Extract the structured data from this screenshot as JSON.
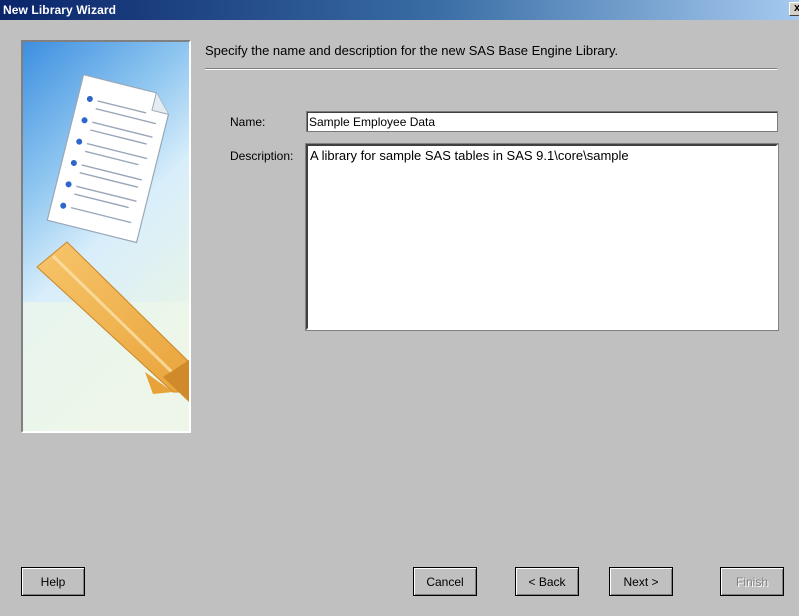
{
  "window": {
    "title": "New Library Wizard",
    "close_glyph": "x"
  },
  "page": {
    "instruction": "Specify the name and description for the new SAS Base Engine Library.",
    "name_label": "Name:",
    "name_value": "Sample Employee Data",
    "description_label": "Description:",
    "description_value": "A library for sample SAS tables in SAS 9.1\\core\\sample"
  },
  "buttons": {
    "help": "Help",
    "cancel": "Cancel",
    "back": "< Back",
    "next": "Next >",
    "finish": "Finish"
  },
  "colors": {
    "title_start": "#0a246a",
    "title_end": "#a6caf0",
    "dialog_bg": "#c0c0c0"
  }
}
